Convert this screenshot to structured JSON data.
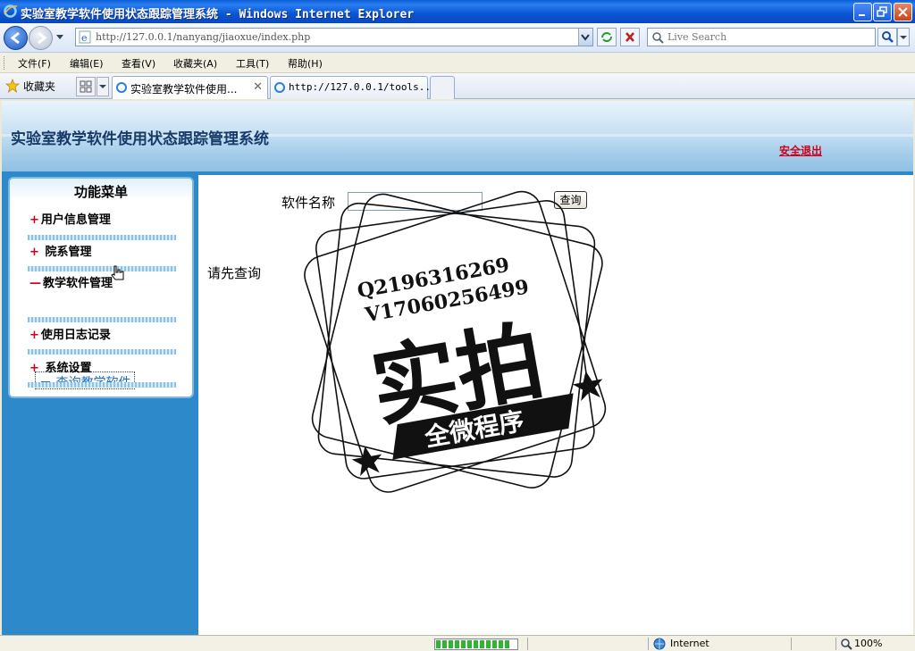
{
  "window": {
    "title": "实验室教学软件使用状态跟踪管理系统 - Windows Internet Explorer"
  },
  "addressbar": {
    "url": "http://127.0.0.1/nanyang/jiaoxue/index.php",
    "search_placeholder": "Live Search"
  },
  "menubar": {
    "items": [
      "文件(F)",
      "编辑(E)",
      "查看(V)",
      "收藏夹(A)",
      "工具(T)",
      "帮助(H)"
    ]
  },
  "tabs": {
    "favorites_label": "收藏夹",
    "items": [
      {
        "label": "实验室教学软件使用..."
      },
      {
        "label": "http://127.0.0.1/tools..."
      }
    ]
  },
  "page": {
    "system_title": "实验室教学软件使用状态跟踪管理系统",
    "logout": "安全退出",
    "sidebar": {
      "title": "功能菜单",
      "items": [
        {
          "mark": "+",
          "label": "用户信息管理"
        },
        {
          "mark": "+",
          "label": "院系管理"
        },
        {
          "mark": "—",
          "label": "教学软件管理"
        },
        {
          "mark": "+",
          "label": "使用日志记录"
        },
        {
          "mark": "+",
          "label": "系统设置"
        }
      ],
      "subitem": "－ 查询教学软件"
    },
    "main": {
      "software_name_label": "软件名称",
      "software_name_value": "",
      "query_button": "查询",
      "hint": "请先查询"
    },
    "watermark": {
      "line1": "Q2196316269",
      "line2": "V17060256499",
      "big_text": "实拍",
      "ribbon_text": "全微程序"
    }
  },
  "statusbar": {
    "zone": "Internet",
    "zoom": "100%",
    "progress": 1.0
  },
  "colors": {
    "title_bar": "#0a5fd8",
    "page_blue": "#2d89c9",
    "logout_red": "#d0001c",
    "link_blue": "#1b6ec1"
  }
}
